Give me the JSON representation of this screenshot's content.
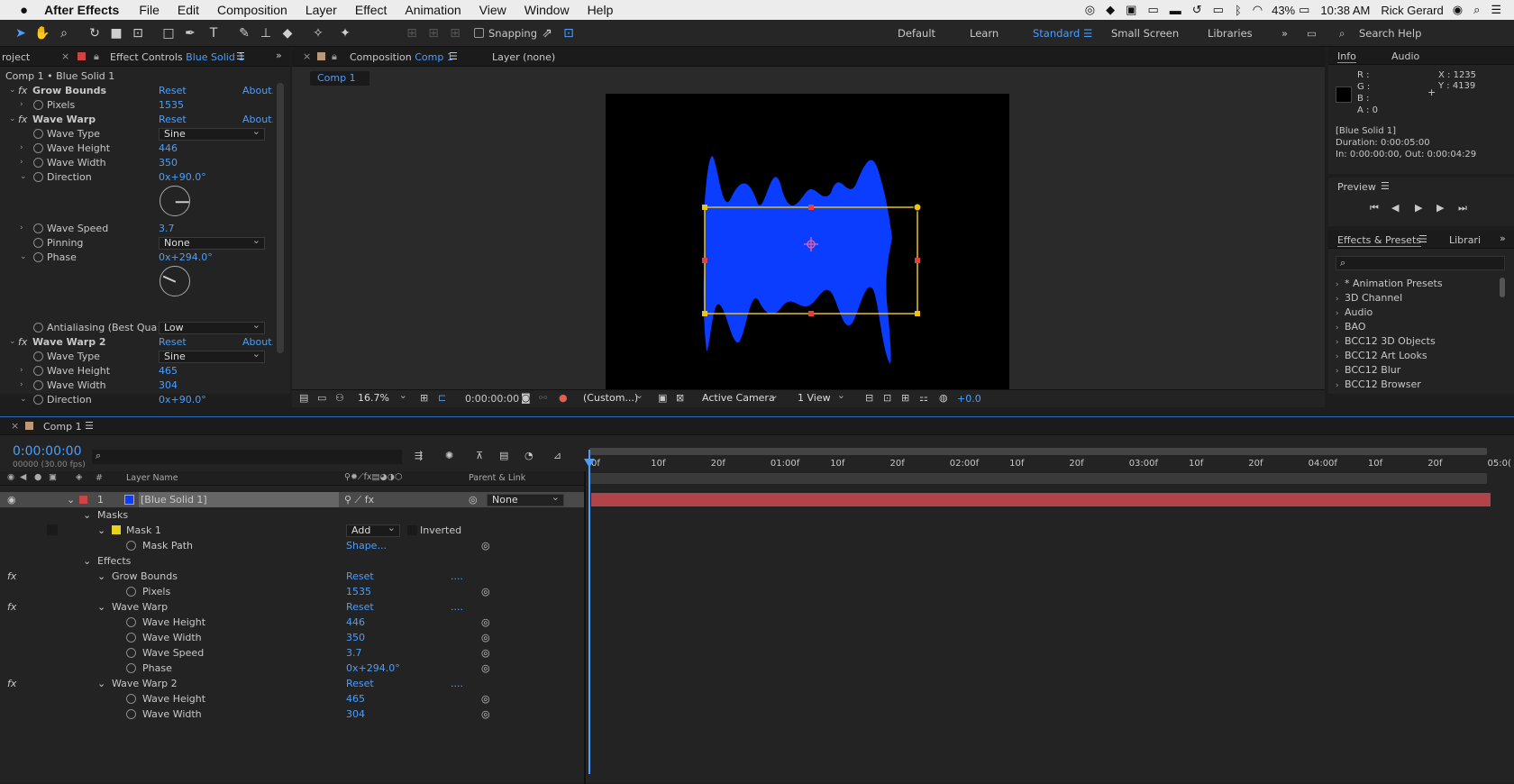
{
  "menubar": {
    "apple_icon": "apple-icon",
    "app": "After Effects",
    "items": [
      "File",
      "Edit",
      "Composition",
      "Layer",
      "Effect",
      "Animation",
      "View",
      "Window",
      "Help"
    ],
    "battery": "43%",
    "time": "10:38 AM",
    "user": "Rick Gerard"
  },
  "toolbar": {
    "snapping": "Snapping",
    "workspaces": [
      "Default",
      "Learn",
      "Standard",
      "Small Screen",
      "Libraries"
    ],
    "search_placeholder": "Search Help"
  },
  "effect_controls": {
    "project_tab": "roject",
    "tab_prefix": "Effect Controls",
    "layer_name": "Blue Solid 1",
    "crumb": "Comp 1 • Blue Solid 1",
    "rows": [
      {
        "label": "Grow Bounds",
        "reset": "Reset",
        "about": "About..."
      },
      {
        "label": "Pixels",
        "value": "1535"
      },
      {
        "label": "Wave Warp",
        "reset": "Reset",
        "about": "About..."
      },
      {
        "label": "Wave Type",
        "value": "Sine"
      },
      {
        "label": "Wave Height",
        "value": "446"
      },
      {
        "label": "Wave Width",
        "value": "350"
      },
      {
        "label": "Direction",
        "value": "0x+90.0°"
      },
      {
        "label": "Wave Speed",
        "value": "3.7"
      },
      {
        "label": "Pinning",
        "value": "None"
      },
      {
        "label": "Phase",
        "value": "0x+294.0°"
      },
      {
        "label": "Antialiasing (Best Qualit",
        "value": "Low"
      },
      {
        "label": "Wave Warp 2",
        "reset": "Reset",
        "about": "About..."
      },
      {
        "label": "Wave Type",
        "value": "Sine"
      },
      {
        "label": "Wave Height",
        "value": "465"
      },
      {
        "label": "Wave Width",
        "value": "304"
      },
      {
        "label": "Direction",
        "value": "0x+90.0°"
      }
    ]
  },
  "composition": {
    "tab_prefix": "Composition",
    "comp_name": "Comp 1",
    "layer_tab": "Layer (none)",
    "sub_tab": "Comp 1",
    "footer": {
      "zoom": "16.7%",
      "timecode": "0:00:00:00",
      "resolution": "(Custom...)",
      "camera": "Active Camera",
      "views": "1 View",
      "exposure": "+0.0"
    }
  },
  "info": {
    "tab": "Info",
    "audio_tab": "Audio",
    "r": "R :",
    "g": "G :",
    "b": "B :",
    "a": "A :  0",
    "x": "X : 1235",
    "y": "Y : 4139",
    "name": "[Blue Solid 1]",
    "duration": "Duration: 0:00:05:00",
    "inout": "In: 0:00:00:00, Out: 0:00:04:29"
  },
  "preview": {
    "title": "Preview"
  },
  "effects_presets": {
    "tab": "Effects & Presets",
    "lib_tab": "Librari",
    "items": [
      "* Animation Presets",
      "3D Channel",
      "Audio",
      "BAO",
      "BCC12 3D Objects",
      "BCC12 Art Looks",
      "BCC12 Blur",
      "BCC12 Browser"
    ]
  },
  "timeline": {
    "tab": "Comp 1",
    "timecode": "0:00:00:00",
    "fps": "00000 (30.00 fps)",
    "col_num": "#",
    "col_layer": "Layer Name",
    "col_parent": "Parent & Link",
    "ruler": [
      "0f",
      "10f",
      "20f",
      "01:00f",
      "10f",
      "20f",
      "02:00f",
      "10f",
      "20f",
      "03:00f",
      "10f",
      "20f",
      "04:00f",
      "10f",
      "20f",
      "05:0("
    ],
    "layer": {
      "num": "1",
      "name": "[Blue Solid 1]",
      "parent": "None"
    },
    "masks": "Masks",
    "mask1": "Mask 1",
    "mask_mode": "Add",
    "inverted": "Inverted",
    "mask_path": "Mask Path",
    "shape": "Shape...",
    "effects": "Effects",
    "grow_bounds": "Grow Bounds",
    "reset": "Reset",
    "dots": "....",
    "pixels": "Pixels",
    "pixels_val": "1535",
    "wave_warp": "Wave Warp",
    "wh": "Wave Height",
    "wh_val": "446",
    "ww": "Wave Width",
    "ww_val": "350",
    "wsp": "Wave Speed",
    "wsp_val": "3.7",
    "phase": "Phase",
    "phase_val": "0x+294.0°",
    "wave_warp2": "Wave Warp 2",
    "wh2_val": "465",
    "ww2_val": "304"
  },
  "colors": {
    "accent": "#4a9eff",
    "layer_blue": "#0a3dff",
    "bar": "#b04448"
  }
}
